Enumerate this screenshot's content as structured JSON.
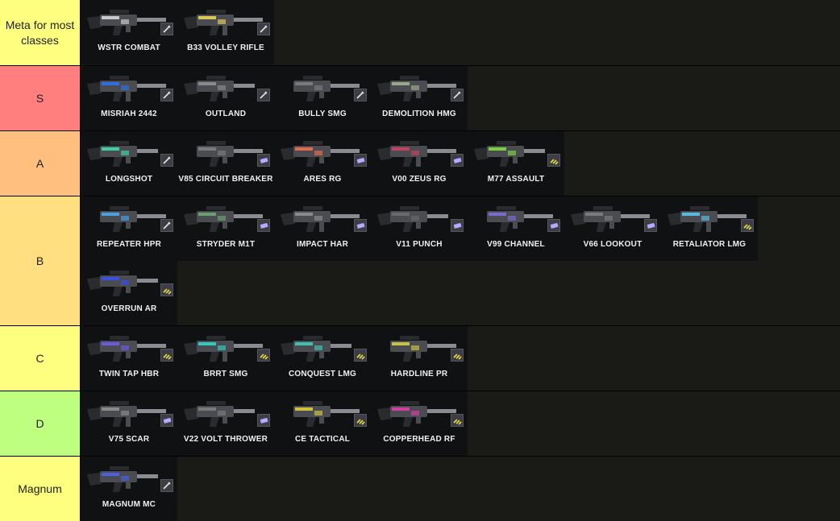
{
  "tiers": [
    {
      "label": "Meta for most classes",
      "color": "#ffff7f",
      "items": [
        {
          "name": "WSTR COMBAT",
          "icon": "pencil-icon",
          "accent": "#c9c9c9"
        },
        {
          "name": "B33 VOLLEY RIFLE",
          "icon": "pencil-icon",
          "accent": "#d8c85a"
        }
      ]
    },
    {
      "label": "S",
      "color": "#ff7f7f",
      "items": [
        {
          "name": "MISRIAH 2442",
          "icon": "pencil-icon",
          "accent": "#2f6fe0"
        },
        {
          "name": "OUTLAND",
          "icon": "pencil-icon",
          "accent": "#8a8a8a"
        },
        {
          "name": "BULLY SMG",
          "icon": "pencil-icon",
          "accent": "#7a7a7a"
        },
        {
          "name": "DEMOLITION HMG",
          "icon": "pencil-icon",
          "accent": "#9aa88a"
        }
      ]
    },
    {
      "label": "A",
      "color": "#ffbf7f",
      "items": [
        {
          "name": "LONGSHOT",
          "icon": "pencil-icon",
          "accent": "#3fd0a0"
        },
        {
          "name": "V85 CIRCUIT BREAKER",
          "icon": "chip-icon",
          "accent": "#7a7a7a"
        },
        {
          "name": "ARES RG",
          "icon": "chip-icon",
          "accent": "#e06a4a"
        },
        {
          "name": "V00 ZEUS RG",
          "icon": "chip-icon",
          "accent": "#c84060"
        },
        {
          "name": "M77 ASSAULT",
          "icon": "ammo-icon",
          "accent": "#7ad040"
        }
      ]
    },
    {
      "label": "B",
      "color": "#ffdf7f",
      "items": [
        {
          "name": "REPEATER HPR",
          "icon": "pencil-icon",
          "accent": "#4aa0e0"
        },
        {
          "name": "STRYDER M1T",
          "icon": "chip-icon",
          "accent": "#6aa070"
        },
        {
          "name": "IMPACT HAR",
          "icon": "chip-icon",
          "accent": "#8a8a8a"
        },
        {
          "name": "V11 PUNCH",
          "icon": "chip-icon",
          "accent": "#6a6a6a"
        },
        {
          "name": "V99 CHANNEL",
          "icon": "chip-icon",
          "accent": "#7a6ad0"
        },
        {
          "name": "V66 LOOKOUT",
          "icon": "chip-icon",
          "accent": "#7a7a7a"
        },
        {
          "name": "RETALIATOR LMG",
          "icon": "ammo-icon",
          "accent": "#5ab8e0"
        },
        {
          "name": "OVERRUN AR",
          "icon": "ammo-icon",
          "accent": "#3a50e0"
        }
      ]
    },
    {
      "label": "C",
      "color": "#ffff7f",
      "items": [
        {
          "name": "TWIN TAP HBR",
          "icon": "ammo-icon",
          "accent": "#6a5ae0"
        },
        {
          "name": "BRRT SMG",
          "icon": "ammo-icon",
          "accent": "#30c8c0"
        },
        {
          "name": "CONQUEST LMG",
          "icon": "ammo-icon",
          "accent": "#40c0b0"
        },
        {
          "name": "HARDLINE PR",
          "icon": "ammo-icon",
          "accent": "#c8c040"
        }
      ]
    },
    {
      "label": "D",
      "color": "#bfff7f",
      "items": [
        {
          "name": "V75 SCAR",
          "icon": "chip-icon",
          "accent": "#8a8a8a"
        },
        {
          "name": "V22 VOLT THROWER",
          "icon": "chip-icon",
          "accent": "#7a7a7a"
        },
        {
          "name": "CE TACTICAL",
          "icon": "ammo-icon",
          "accent": "#d0c040"
        },
        {
          "name": "COPPERHEAD RF",
          "icon": "ammo-icon",
          "accent": "#d040a0"
        }
      ]
    },
    {
      "label": "Magnum",
      "color": "#ffff7f",
      "items": [
        {
          "name": "MAGNUM MC",
          "icon": "pencil-icon",
          "accent": "#4a60e0"
        }
      ]
    }
  ]
}
